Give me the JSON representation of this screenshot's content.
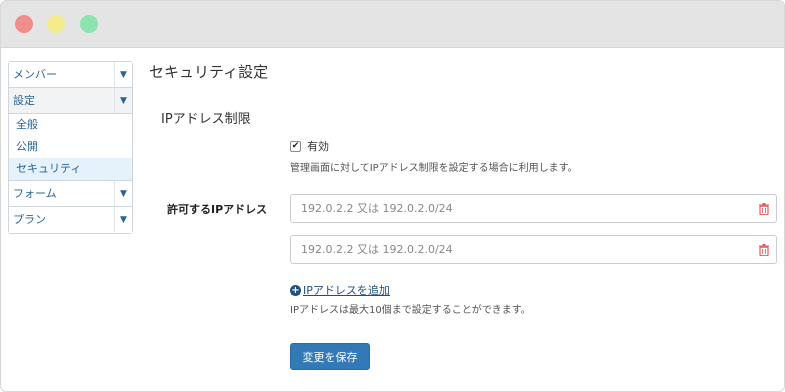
{
  "colors": {
    "accent": "#3379b7",
    "link": "#2a6496",
    "active_bg": "#e5f1fb",
    "trash": "#e05a5a"
  },
  "sidebar": {
    "groups": [
      {
        "label": "メンバー",
        "icon": "caret-down-icon"
      },
      {
        "label": "設定",
        "icon": "caret-down-icon",
        "items": [
          {
            "label": "全般"
          },
          {
            "label": "公開"
          },
          {
            "label": "セキュリティ",
            "active": true
          }
        ]
      },
      {
        "label": "フォーム",
        "icon": "caret-down-icon"
      },
      {
        "label": "プラン",
        "icon": "caret-down-icon"
      }
    ]
  },
  "main": {
    "title": "セキュリティ設定",
    "section_title": "IPアドレス制限",
    "enable": {
      "label": "有効",
      "checked": true
    },
    "enable_help": "管理画面に対してIPアドレス制限を設定する場合に利用します。",
    "field_label": "許可するIPアドレス",
    "ip_inputs": [
      {
        "placeholder": "192.0.2.2 又は 192.0.2.0/24",
        "value": "",
        "icon": "trash-icon"
      },
      {
        "placeholder": "192.0.2.2 又は 192.0.2.0/24",
        "value": "",
        "icon": "trash-icon"
      }
    ],
    "add_link": "IPアドレスを追加",
    "add_icon": "plus-circle-icon",
    "limit_help": "IPアドレスは最大10個まで設定することができます。",
    "save_label": "変更を保存"
  }
}
